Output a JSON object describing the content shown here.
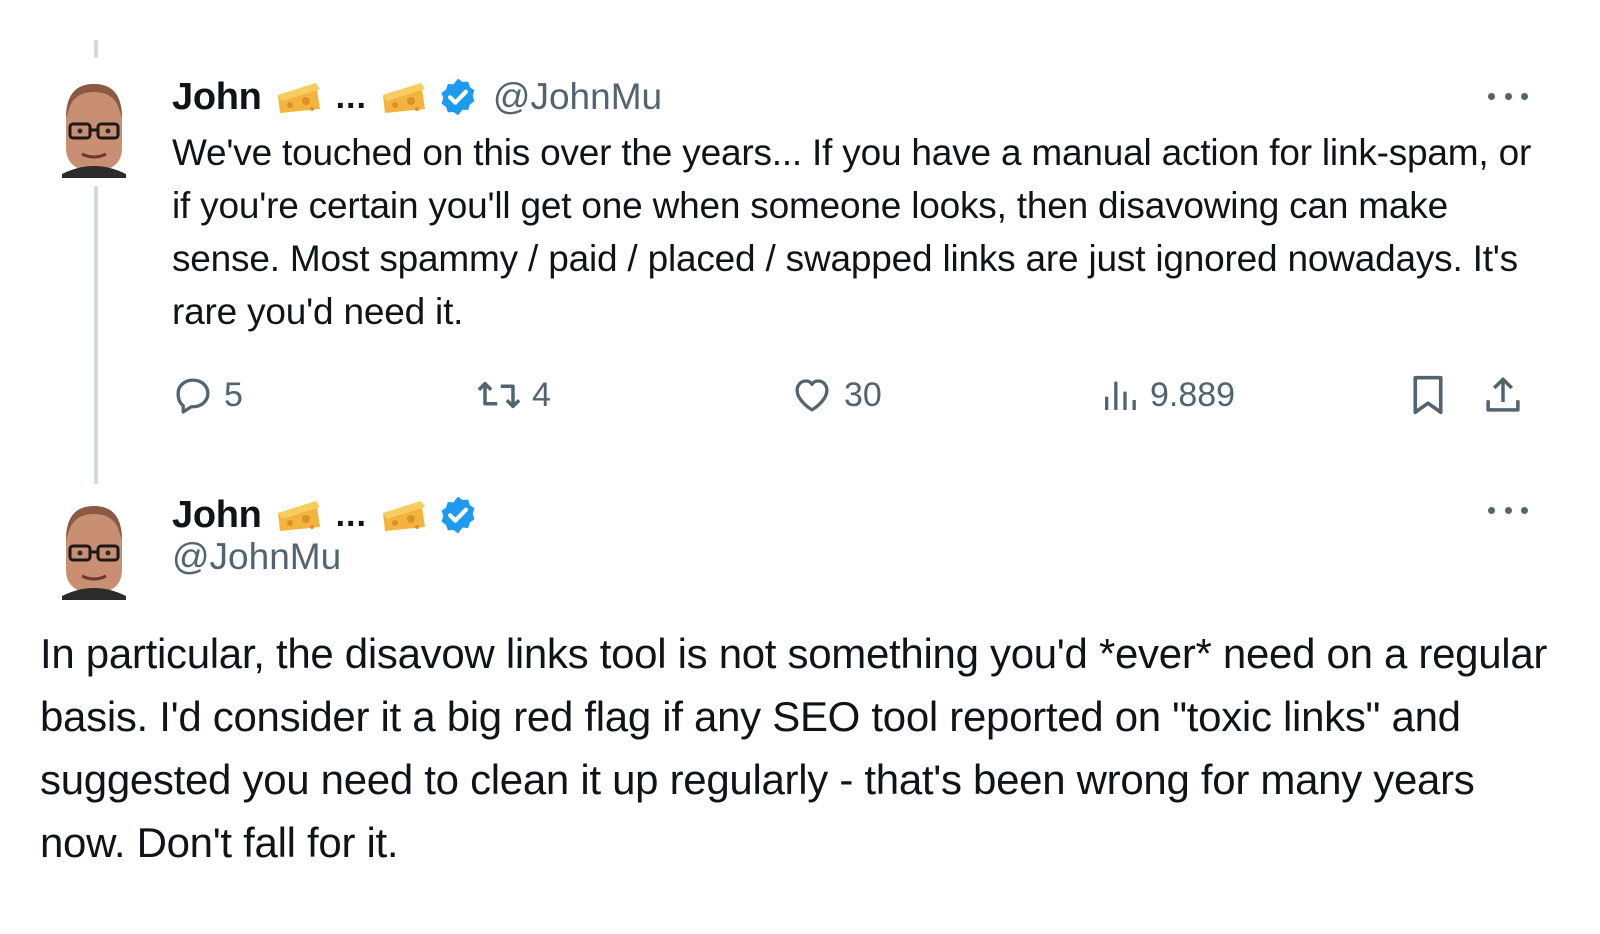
{
  "tweet1": {
    "author_name": "John",
    "name_ellipsis": "...",
    "handle": "@JohnMu",
    "text": "We've touched on this over the years...  If you have a manual action for link-spam, or if you're certain you'll get one when someone looks, then disavowing can make sense. Most spammy / paid / placed / swapped links are just ignored nowadays. It's rare you'd need it.",
    "reply_count": "5",
    "retweet_count": "4",
    "like_count": "30",
    "view_count": "9.889"
  },
  "tweet2": {
    "author_name": "John",
    "name_ellipsis": "...",
    "handle": "@JohnMu",
    "text": "In particular, the disavow links tool is not something you'd *ever* need on a regular basis. I'd consider it a big red flag if any SEO tool reported on \"toxic links\" and suggested you need to clean it up regularly - that's been wrong for many years now. Don't fall for it."
  },
  "icons": {
    "verified": "verified-badge-icon",
    "cheese": "cheese-emoji-icon",
    "more": "more-options-icon",
    "reply": "reply-icon",
    "retweet": "retweet-icon",
    "like": "heart-icon",
    "views": "views-icon",
    "bookmark": "bookmark-icon",
    "share": "share-icon"
  },
  "colors": {
    "text_primary": "#0f1419",
    "text_secondary": "#536471",
    "verified_blue": "#1d9bf0",
    "thread_line": "#cfd9de",
    "cheese": "#f4b33c"
  }
}
